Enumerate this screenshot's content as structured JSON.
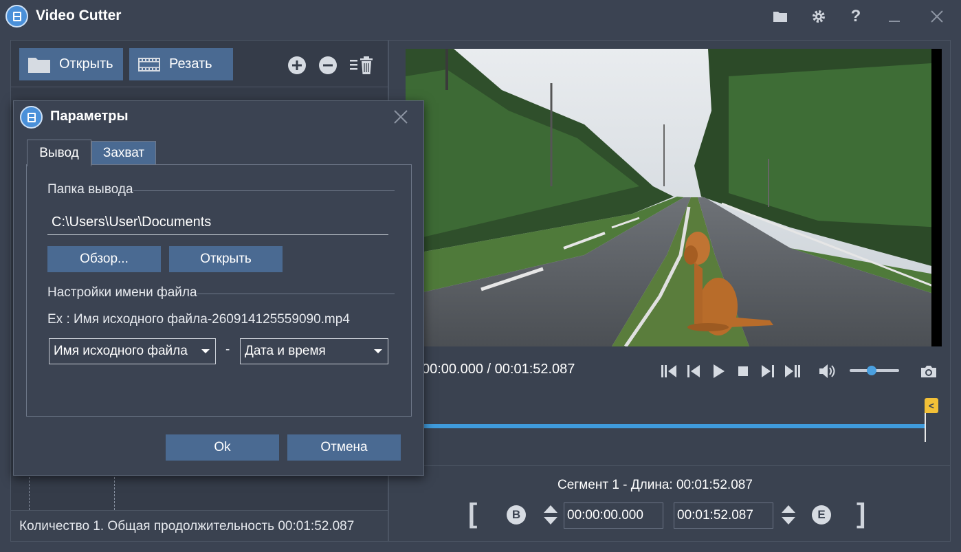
{
  "app": {
    "title": "Video Cutter"
  },
  "titlebar": {
    "icons": [
      "folder-icon",
      "gear-icon",
      "help-icon",
      "minimize-icon",
      "close-icon"
    ],
    "help_label": "?"
  },
  "toolbar": {
    "open_label": "Открыть",
    "cut_label": "Резать",
    "icons": [
      "add-icon",
      "remove-icon",
      "clear-list-icon"
    ]
  },
  "file_list": {
    "status_text": "Количество 1. Общая продолжительность 00:01:52.087"
  },
  "player": {
    "time_text": "00:00.000 / 00:01:52.087",
    "controls": [
      "prev-keyframe-icon",
      "prev-frame-icon",
      "play-icon",
      "stop-icon",
      "next-frame-icon",
      "next-keyframe-icon",
      "volume-icon",
      "snapshot-icon"
    ],
    "volume": 0.45,
    "marker_label": "<"
  },
  "segment": {
    "label": "Сегмент 1 - Длина: 00:01:52.087",
    "start_bracket": "[",
    "end_bracket": "]",
    "begin_button": "B",
    "end_button": "E",
    "start_time": "00:00:00.000",
    "end_time": "00:01:52.087"
  },
  "dialog": {
    "title": "Параметры",
    "tabs": [
      {
        "label": "Вывод",
        "active": true
      },
      {
        "label": "Захват",
        "active": false
      }
    ],
    "output_folder_label": "Папка вывода",
    "output_path": "C:\\Users\\User\\Documents",
    "browse_label": "Обзор...",
    "open_label": "Открыть",
    "filename_settings_label": "Настройки имени файла",
    "example_text": "Ex : Имя исходного файла-260914125559090.mp4",
    "name_part1": "Имя исходного файла",
    "separator": "-",
    "name_part2": "Дата и время",
    "ok_label": "Ok",
    "cancel_label": "Отмена"
  },
  "colors": {
    "background": "#3b4352",
    "button": "#4a6a92",
    "accent": "#3f9bdc",
    "marker": "#f2c037"
  }
}
